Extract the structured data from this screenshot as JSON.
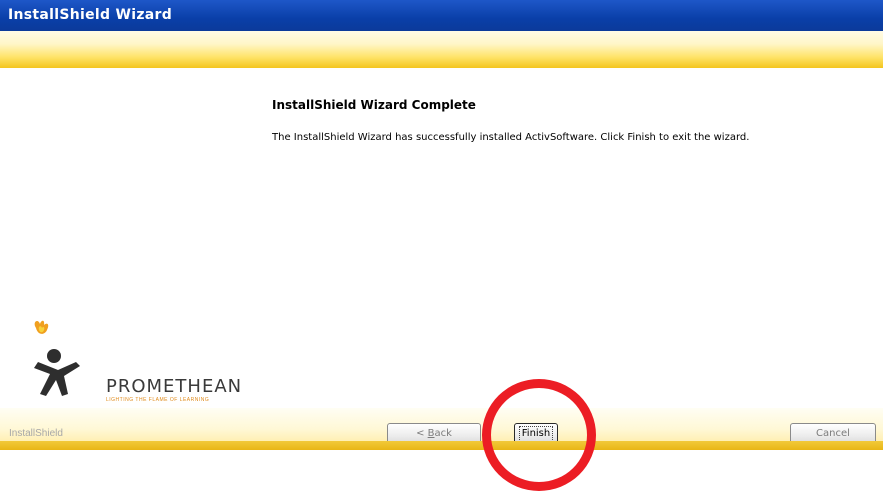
{
  "window": {
    "title": "InstallShield Wizard"
  },
  "main": {
    "heading": "InstallShield Wizard Complete",
    "message": "The InstallShield Wizard has successfully installed ActivSoftware.  Click Finish to exit the wizard."
  },
  "logo": {
    "name": "PROMETHEAN",
    "tagline": "LIGHTING THE FLAME OF LEARNING"
  },
  "footer": {
    "brand": "InstallShield",
    "back_prefix": "< ",
    "back_mnemonic": "B",
    "back_rest": "ack",
    "finish_label": "Finish",
    "cancel_label": "Cancel"
  },
  "colors": {
    "titlebar": "#0b3fa8",
    "banner_yellow": "#f4c51e",
    "annotation_circle": "#ec1d24",
    "logo_flame": "#f0a020"
  },
  "icons": [
    "promethean-flame-logo",
    "annotation-circle"
  ]
}
